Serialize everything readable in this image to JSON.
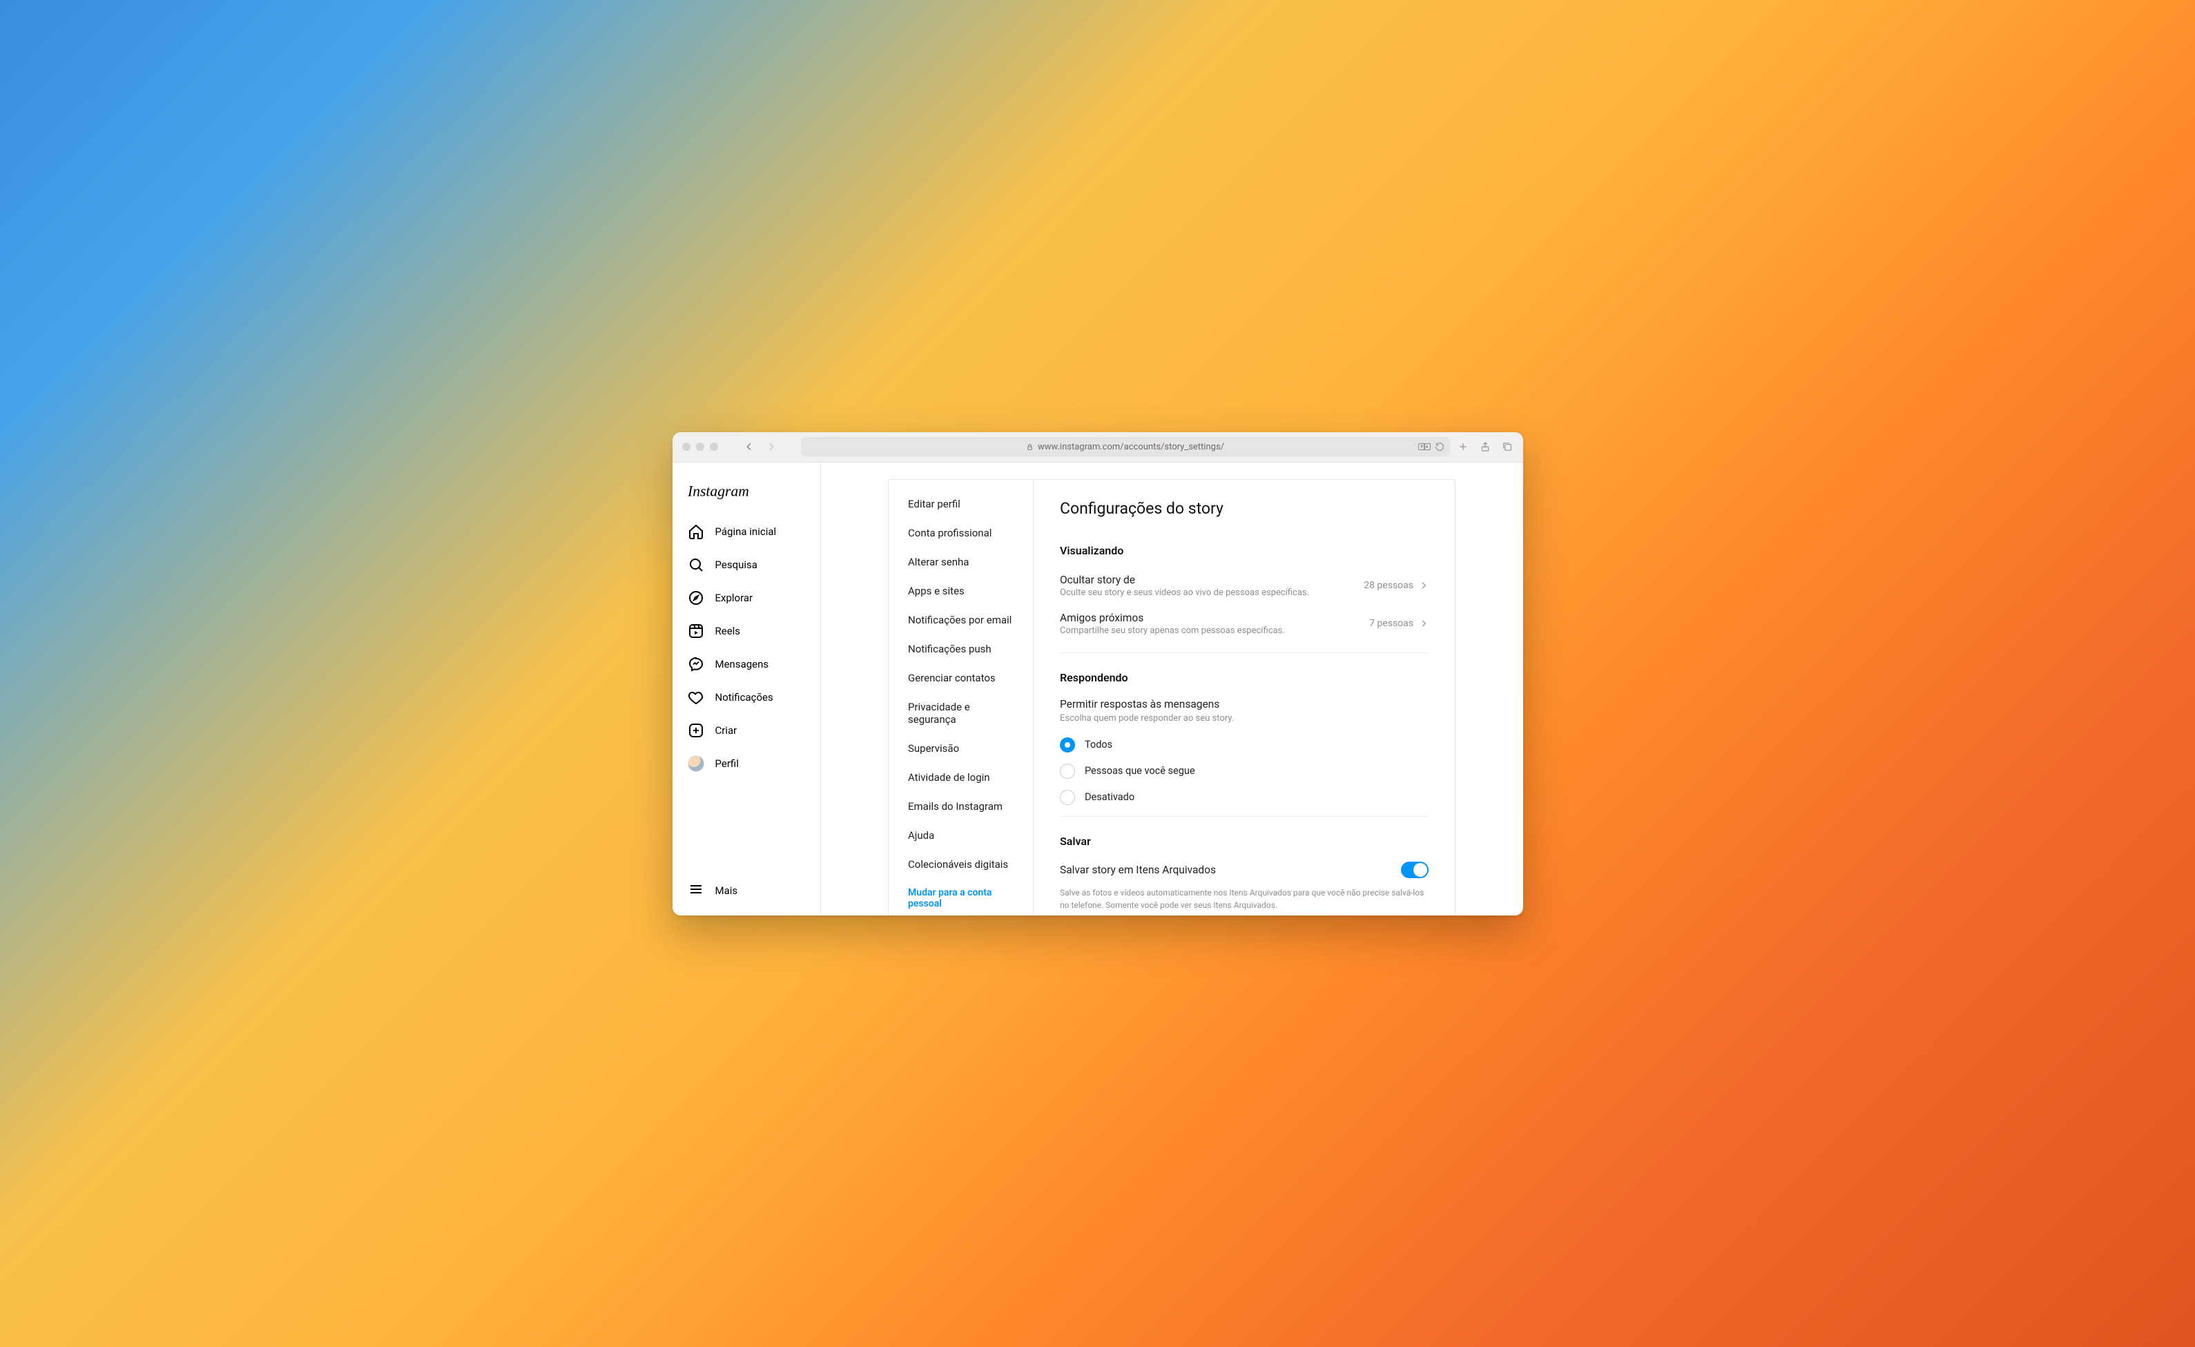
{
  "browser": {
    "url": "www.instagram.com/accounts/story_settings/"
  },
  "sidebar": {
    "brand": "Instagram",
    "items": [
      {
        "label": "Página inicial"
      },
      {
        "label": "Pesquisa"
      },
      {
        "label": "Explorar"
      },
      {
        "label": "Reels"
      },
      {
        "label": "Mensagens"
      },
      {
        "label": "Notificações"
      },
      {
        "label": "Criar"
      },
      {
        "label": "Perfil"
      }
    ],
    "more": "Mais"
  },
  "settings_nav": [
    "Editar perfil",
    "Conta profissional",
    "Alterar senha",
    "Apps e sites",
    "Notificações por email",
    "Notificações push",
    "Gerenciar contatos",
    "Privacidade e segurança",
    "Supervisão",
    "Atividade de login",
    "Emails do Instagram",
    "Ajuda",
    "Colecionáveis digitais"
  ],
  "settings_nav_link": "Mudar para a conta pessoal",
  "page": {
    "title": "Configurações do story",
    "viewing": {
      "heading": "Visualizando",
      "hide": {
        "label": "Ocultar story de",
        "sub": "Oculte seu story e seus vídeos ao vivo de pessoas específicas.",
        "count": "28 pessoas"
      },
      "close_friends": {
        "label": "Amigos próximos",
        "sub": "Compartilhe seu story apenas com pessoas específicas.",
        "count": "7 pessoas"
      }
    },
    "replying": {
      "heading": "Respondendo",
      "label": "Permitir respostas às mensagens",
      "sub": "Escolha quem pode responder ao seu story.",
      "options": [
        "Todos",
        "Pessoas que você segue",
        "Desativado"
      ],
      "selected": 0
    },
    "saving": {
      "heading": "Salvar",
      "archive_label": "Salvar story em Itens Arquivados",
      "archive_on": true,
      "note": "Salve as fotos e vídeos automaticamente nos Itens Arquivados para que você não precise salvá-los no telefone. Somente você pode ver seus Itens Arquivados."
    }
  }
}
